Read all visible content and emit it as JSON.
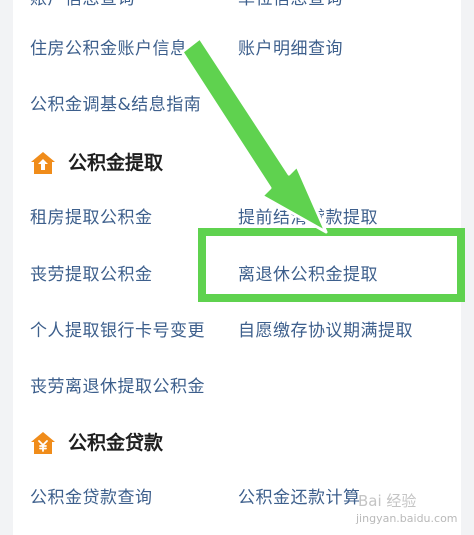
{
  "top_partial": {
    "left": "账户信息查询",
    "right": "单位信息查询"
  },
  "section_account": {
    "items": [
      "住房公积金账户信息",
      "账户明细查询",
      "公积金调基&结息指南"
    ]
  },
  "section_withdraw": {
    "title": "公积金提取",
    "icon": "house-up-arrow-icon",
    "items": [
      "租房提取公积金",
      "提前结清贷款提取",
      "丧劳提取公积金",
      "离退休公积金提取",
      "个人提取银行卡号变更",
      "自愿缴存协议期满提取",
      "丧劳离退休提取公积金"
    ]
  },
  "section_loan": {
    "title": "公积金贷款",
    "icon": "house-yen-icon",
    "items": [
      "公积金贷款查询",
      "公积金还款计算"
    ]
  },
  "annotation": {
    "color": "#5fd24f"
  },
  "colors": {
    "link": "#3d5f8c",
    "icon": "#f08c1a"
  },
  "watermark": {
    "brand": "Bai 经验",
    "url": "jingyan.baidu.com"
  }
}
